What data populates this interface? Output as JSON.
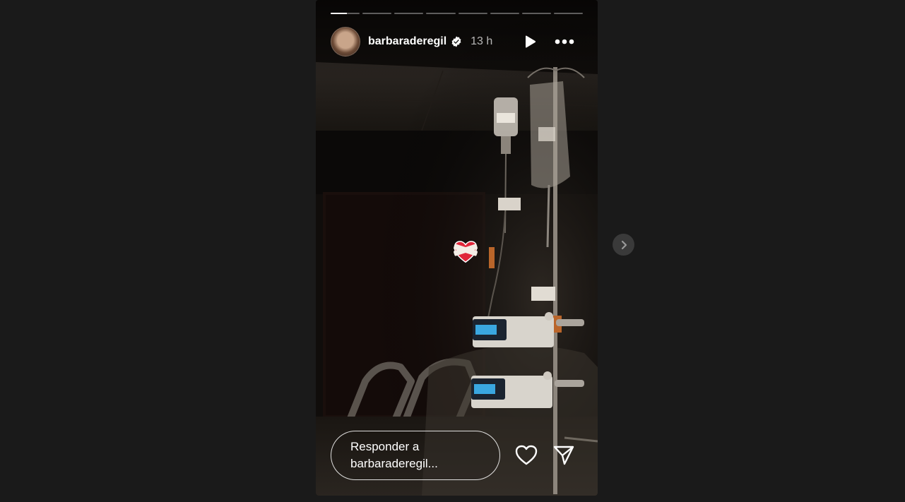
{
  "story": {
    "username": "barbaraderegil",
    "time_ago": "13 h",
    "segments": [
      {
        "progress": 0.55
      },
      {
        "progress": 0
      },
      {
        "progress": 0
      },
      {
        "progress": 0
      },
      {
        "progress": 0
      },
      {
        "progress": 0
      },
      {
        "progress": 0
      },
      {
        "progress": 0
      }
    ],
    "sticker": "mending-heart-emoji",
    "reply_placeholder": "Responder a barbaraderegil...",
    "icons": {
      "verified": "verified-badge-icon",
      "play": "play-icon",
      "more": "more-options-icon",
      "like": "heart-icon",
      "share": "send-icon",
      "next": "chevron-right-icon"
    }
  },
  "colors": {
    "page_background": "#1a1a1a",
    "accent_verified": "#ffffff",
    "next_button": "#3a3a3a"
  }
}
